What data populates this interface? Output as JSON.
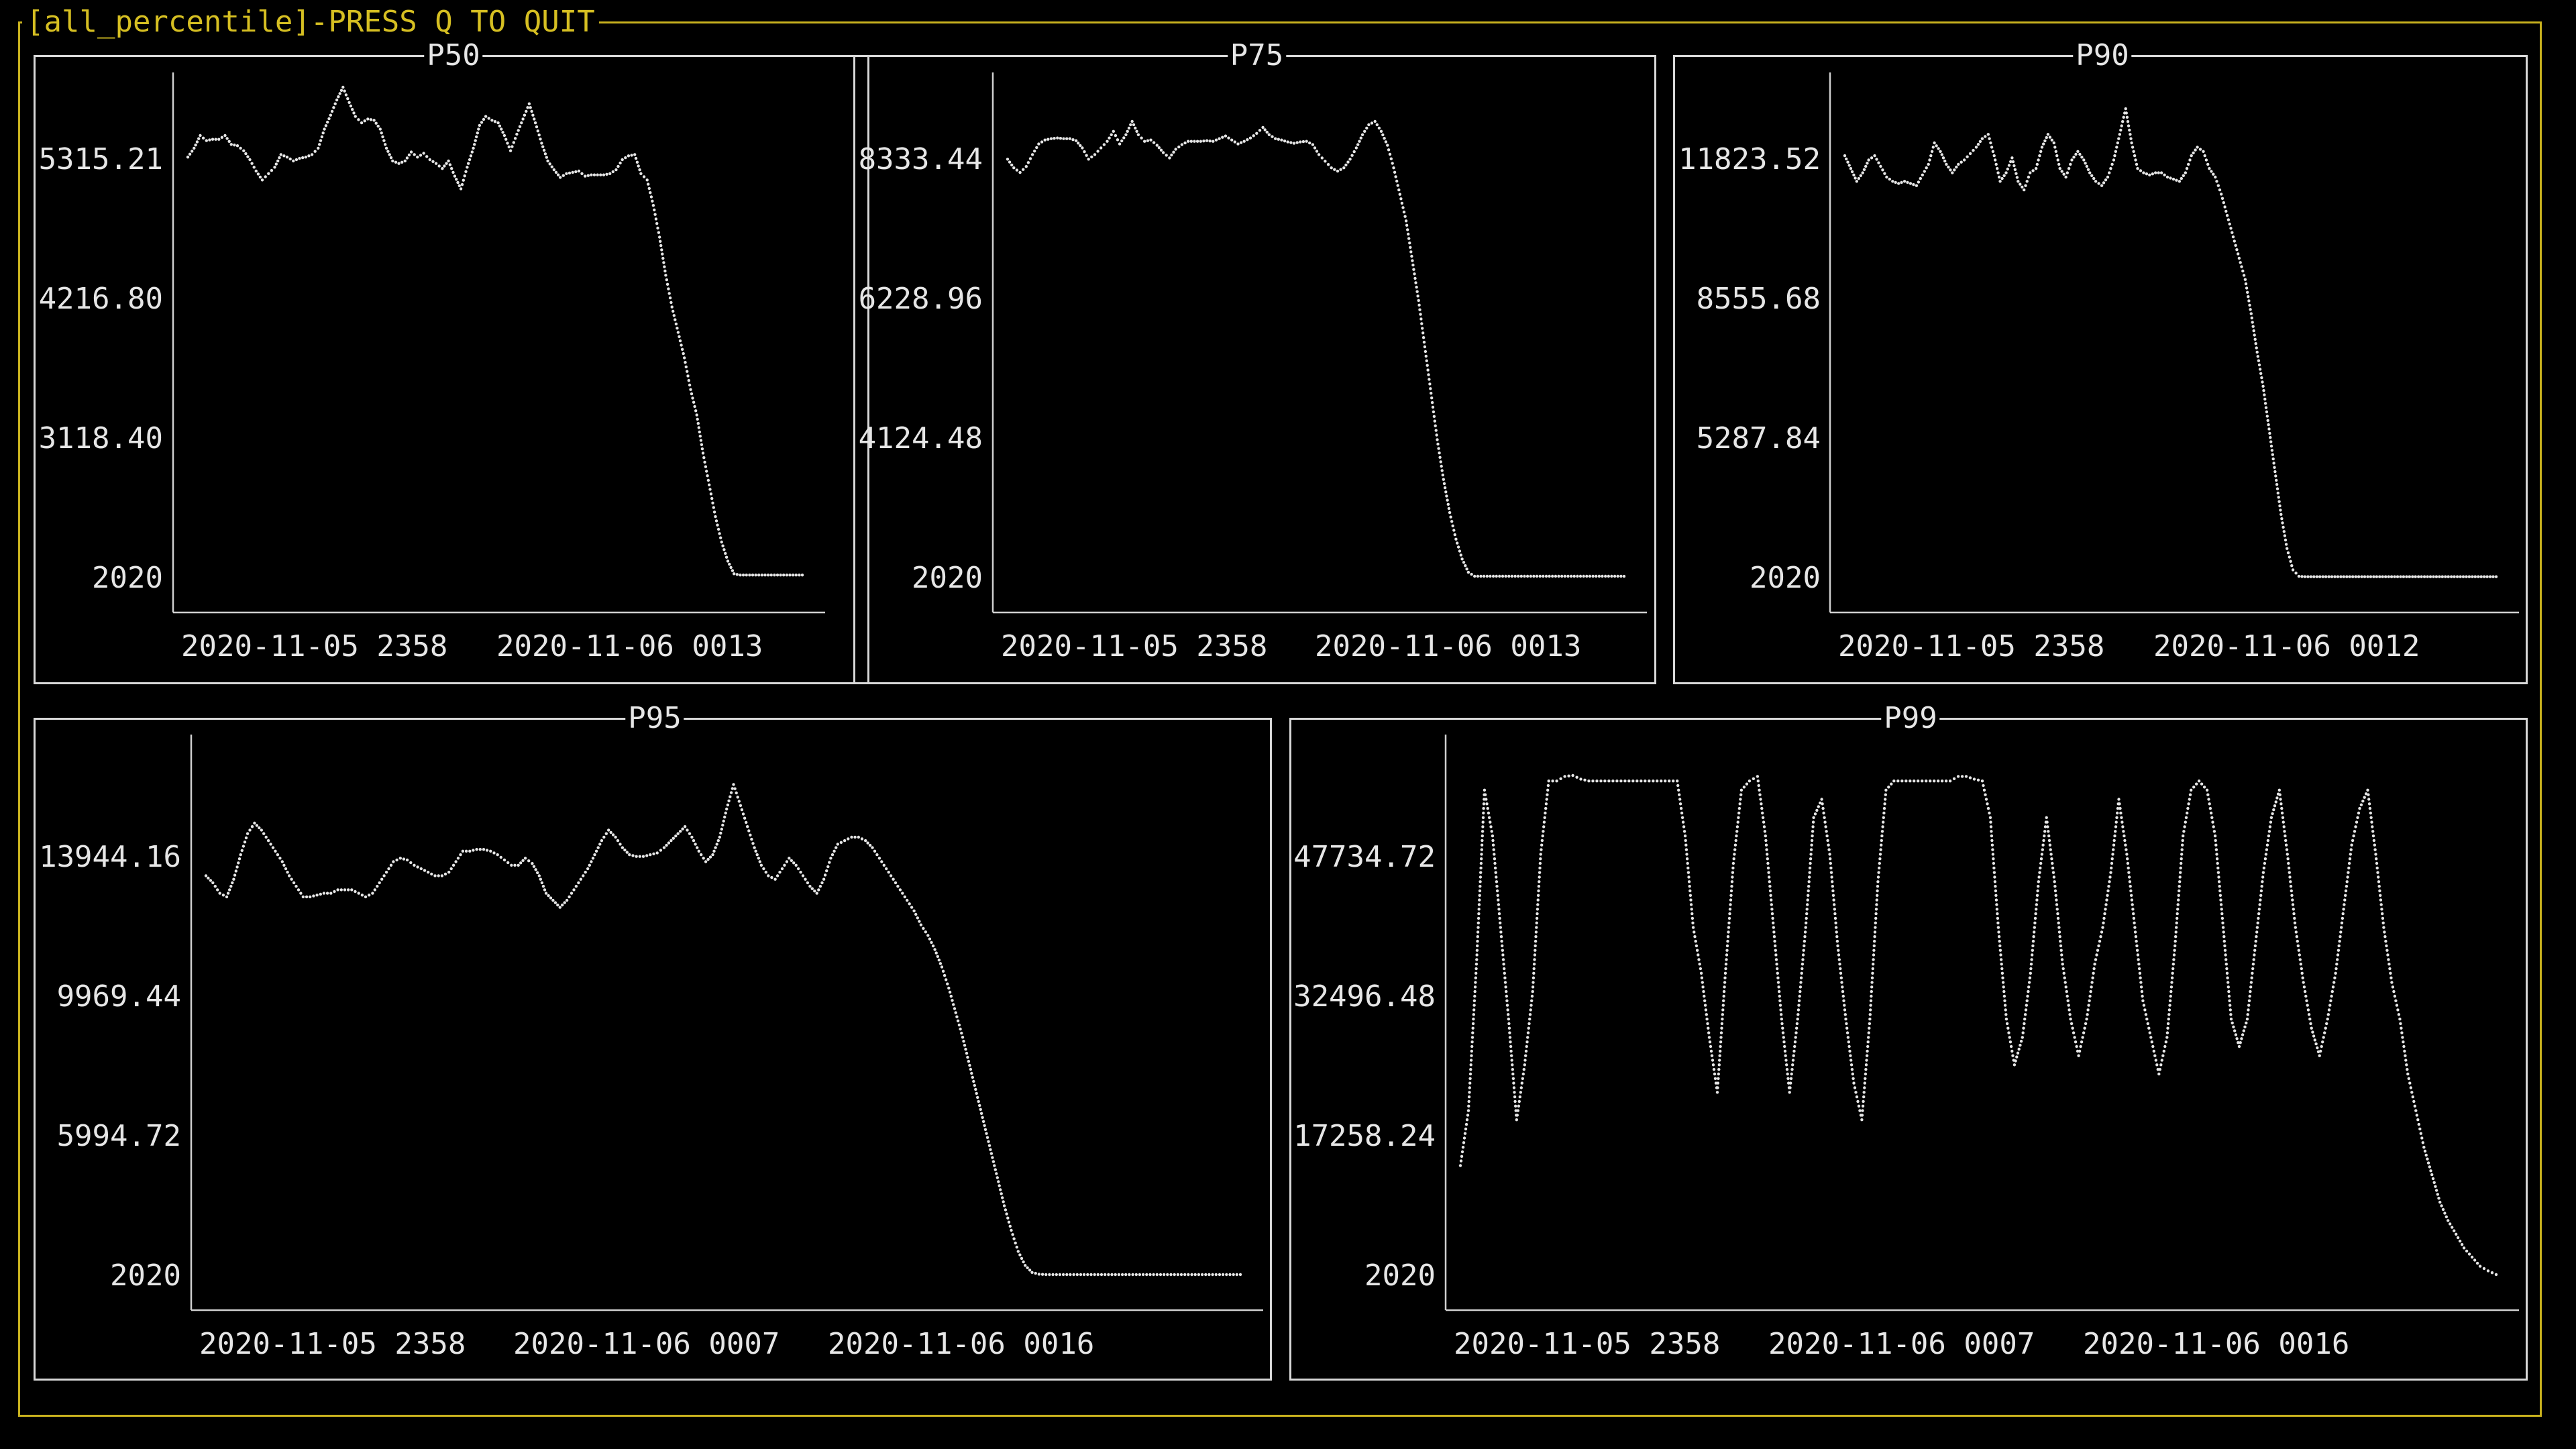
{
  "window": {
    "title": "[all_percentile]-PRESS Q TO QUIT"
  },
  "colors": {
    "frame": "#c9b21e",
    "title": "#d6bf22",
    "panel_border": "#d8d8d8",
    "plot_fg": "#e6e6e6",
    "background": "#000000"
  },
  "chart_data": [
    {
      "type": "line",
      "title": "P50",
      "yticks": [
        "5315.21",
        "4216.80",
        "3118.40",
        "2020"
      ],
      "xticks": [
        "2020-11-05 2358",
        "2020-11-06 0013"
      ],
      "ylim": [
        2020,
        5590
      ],
      "points": 100,
      "values": [
        5330,
        5400,
        5500,
        5460,
        5470,
        5470,
        5500,
        5430,
        5420,
        5380,
        5310,
        5220,
        5150,
        5200,
        5250,
        5350,
        5330,
        5300,
        5320,
        5330,
        5350,
        5400,
        5550,
        5660,
        5780,
        5880,
        5760,
        5650,
        5600,
        5630,
        5620,
        5550,
        5400,
        5300,
        5280,
        5300,
        5370,
        5330,
        5360,
        5310,
        5280,
        5240,
        5300,
        5180,
        5080,
        5250,
        5400,
        5580,
        5650,
        5620,
        5600,
        5500,
        5380,
        5510,
        5630,
        5750,
        5600,
        5440,
        5300,
        5230,
        5170,
        5200,
        5210,
        5220,
        5180,
        5190,
        5190,
        5190,
        5200,
        5230,
        5310,
        5340,
        5350,
        5200,
        5150,
        4950,
        4700,
        4400,
        4150,
        3950,
        3750,
        3500,
        3300,
        3000,
        2750,
        2500,
        2300,
        2150,
        2050,
        2040,
        2040,
        2040,
        2040,
        2040,
        2040,
        2040,
        2040,
        2040,
        2040,
        2040
      ]
    },
    {
      "type": "line",
      "title": "P75",
      "yticks": [
        "8333.44",
        "6228.96",
        "4124.48",
        "2020"
      ],
      "xticks": [
        "2020-11-05 2358",
        "2020-11-06 0013"
      ],
      "ylim": [
        2020,
        8830
      ],
      "points": 100,
      "values": [
        8330,
        8200,
        8130,
        8220,
        8400,
        8560,
        8620,
        8640,
        8650,
        8640,
        8640,
        8610,
        8500,
        8330,
        8400,
        8500,
        8600,
        8750,
        8560,
        8700,
        8900,
        8700,
        8600,
        8620,
        8540,
        8430,
        8350,
        8480,
        8550,
        8600,
        8600,
        8600,
        8610,
        8600,
        8640,
        8680,
        8620,
        8560,
        8600,
        8650,
        8720,
        8810,
        8700,
        8640,
        8620,
        8590,
        8570,
        8590,
        8600,
        8550,
        8400,
        8300,
        8200,
        8150,
        8200,
        8330,
        8500,
        8700,
        8850,
        8900,
        8750,
        8540,
        8200,
        7800,
        7400,
        6800,
        6200,
        5500,
        4800,
        4100,
        3500,
        3000,
        2600,
        2300,
        2100,
        2040,
        2040,
        2040,
        2040,
        2040,
        2040,
        2040,
        2040,
        2040,
        2040,
        2040,
        2040,
        2040,
        2040,
        2040,
        2040,
        2040,
        2040,
        2040,
        2040,
        2040,
        2040,
        2040,
        2040,
        2040
      ]
    },
    {
      "type": "line",
      "title": "P90",
      "yticks": [
        "11823.52",
        "8555.68",
        "5287.84",
        "2020"
      ],
      "xticks": [
        "2020-11-05 2358",
        "2020-11-06 0012"
      ],
      "ylim": [
        2020,
        13150
      ],
      "points": 110,
      "values": [
        11900,
        11600,
        11300,
        11500,
        11800,
        11900,
        11650,
        11400,
        11300,
        11250,
        11300,
        11250,
        11200,
        11450,
        11700,
        12200,
        12000,
        11700,
        11500,
        11700,
        11800,
        11950,
        12100,
        12300,
        12400,
        11900,
        11300,
        11500,
        11850,
        11300,
        11100,
        11500,
        11600,
        12100,
        12400,
        12200,
        11600,
        11400,
        11800,
        12000,
        11800,
        11500,
        11300,
        11200,
        11400,
        11800,
        12400,
        13000,
        12200,
        11600,
        11500,
        11450,
        11500,
        11500,
        11400,
        11350,
        11300,
        11500,
        11900,
        12100,
        12000,
        11600,
        11400,
        11000,
        10500,
        10000,
        9500,
        9000,
        8200,
        7300,
        6500,
        5500,
        4500,
        3500,
        2700,
        2200,
        2050,
        2040,
        2040,
        2040,
        2040,
        2040,
        2040,
        2040,
        2040,
        2040,
        2040,
        2040,
        2040,
        2040,
        2040,
        2040,
        2040,
        2040,
        2040,
        2040,
        2040,
        2040,
        2040,
        2040,
        2040,
        2040,
        2040,
        2040,
        2040,
        2040,
        2040,
        2040,
        2040,
        2040
      ]
    },
    {
      "type": "line",
      "title": "P95",
      "yticks": [
        "13944.16",
        "9969.44",
        "5994.72",
        "2020"
      ],
      "xticks": [
        "2020-11-05 2358",
        "2020-11-06 0007",
        "2020-11-06 0016"
      ],
      "ylim": [
        2020,
        17650
      ],
      "points": 150,
      "values": [
        13400,
        13200,
        12900,
        12800,
        13300,
        14000,
        14600,
        14900,
        14700,
        14400,
        14100,
        13800,
        13400,
        13100,
        12800,
        12800,
        12850,
        12900,
        12900,
        13000,
        13000,
        13000,
        12900,
        12800,
        12900,
        13200,
        13500,
        13800,
        13900,
        13850,
        13700,
        13600,
        13500,
        13400,
        13400,
        13500,
        13800,
        14100,
        14100,
        14150,
        14150,
        14100,
        14000,
        13850,
        13700,
        13700,
        13900,
        13750,
        13400,
        12900,
        12700,
        12500,
        12700,
        13000,
        13300,
        13600,
        14000,
        14400,
        14700,
        14500,
        14200,
        14000,
        13950,
        13950,
        14000,
        14050,
        14200,
        14400,
        14600,
        14800,
        14500,
        14100,
        13800,
        14000,
        14500,
        15300,
        16000,
        15400,
        14800,
        14200,
        13700,
        13400,
        13300,
        13600,
        13900,
        13700,
        13400,
        13100,
        12900,
        13300,
        13900,
        14300,
        14400,
        14500,
        14500,
        14400,
        14200,
        13900,
        13600,
        13300,
        13000,
        12700,
        12400,
        12000,
        11700,
        11300,
        10800,
        10200,
        9500,
        8800,
        8000,
        7200,
        6400,
        5600,
        4800,
        4000,
        3300,
        2700,
        2300,
        2100,
        2050,
        2040,
        2040,
        2040,
        2040,
        2040,
        2040,
        2040,
        2040,
        2040,
        2040,
        2040,
        2040,
        2040,
        2040,
        2040,
        2040,
        2040,
        2040,
        2040,
        2040,
        2040,
        2040,
        2040,
        2040,
        2040,
        2040,
        2040,
        2040,
        2040
      ]
    },
    {
      "type": "line",
      "title": "P99",
      "yticks": [
        "47734.72",
        "32496.48",
        "17258.24",
        "2020"
      ],
      "xticks": [
        "2020-11-05 2358",
        "2020-11-06 0007",
        "2020-11-06 0016"
      ],
      "ylim": [
        2020,
        57500
      ],
      "points": 150,
      "values": [
        14000,
        20000,
        36000,
        55000,
        50000,
        40000,
        30000,
        19000,
        25000,
        33000,
        48000,
        56000,
        56000,
        56500,
        56600,
        56200,
        56000,
        56000,
        56000,
        56000,
        56000,
        56000,
        56000,
        56000,
        56000,
        56000,
        56000,
        56000,
        50000,
        40000,
        35000,
        28000,
        22000,
        35000,
        47000,
        55000,
        56000,
        56500,
        50000,
        40000,
        30000,
        22000,
        30000,
        40000,
        52000,
        54000,
        48000,
        38000,
        30000,
        23000,
        19000,
        30000,
        45000,
        55000,
        56000,
        56000,
        56000,
        56000,
        56000,
        56000,
        56000,
        56000,
        56500,
        56500,
        56200,
        56000,
        52000,
        40000,
        30000,
        25000,
        28000,
        35000,
        45000,
        52000,
        45000,
        36000,
        30000,
        26000,
        30000,
        36000,
        40000,
        46000,
        54000,
        48000,
        40000,
        32000,
        28000,
        24000,
        28000,
        38000,
        50000,
        55000,
        56000,
        55000,
        50000,
        40000,
        30000,
        27000,
        30000,
        38000,
        46000,
        52000,
        55000,
        48000,
        40000,
        34000,
        29000,
        26000,
        30000,
        35000,
        42000,
        49000,
        53000,
        55000,
        48000,
        40000,
        34000,
        30000,
        24000,
        20000,
        16000,
        13000,
        10000,
        8000,
        6500,
        5000,
        4000,
        3000,
        2500,
        2100
      ]
    }
  ]
}
